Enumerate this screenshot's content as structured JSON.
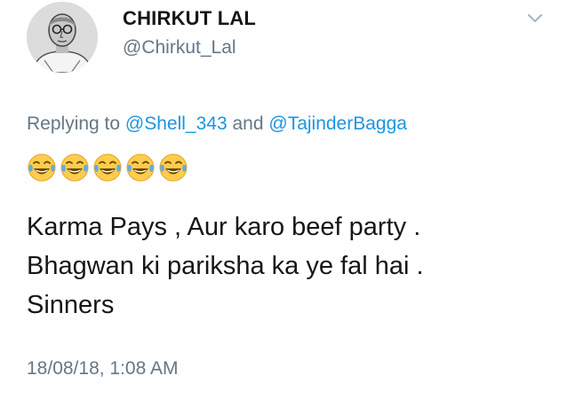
{
  "tweet": {
    "display_name": "CHIRKUT LAL",
    "handle": "@Chirkut_Lal",
    "avatar_icon": "profile-portrait",
    "menu_icon": "chevron-down-icon",
    "reply": {
      "prefix": "Replying to",
      "mention_1": "@Shell_343",
      "joiner": "and",
      "mention_2": "@TajinderBagga"
    },
    "emoji": {
      "name": "face-with-tears-of-joy",
      "count": 5
    },
    "body_lines": [
      "Karma Pays , Aur karo beef party .",
      "Bhagwan ki pariksha ka ye fal hai .",
      "Sinners"
    ],
    "timestamp": "18/08/18, 1:08 AM",
    "colors": {
      "name": "#14171a",
      "secondary": "#657786",
      "link": "#1b95e0"
    }
  }
}
